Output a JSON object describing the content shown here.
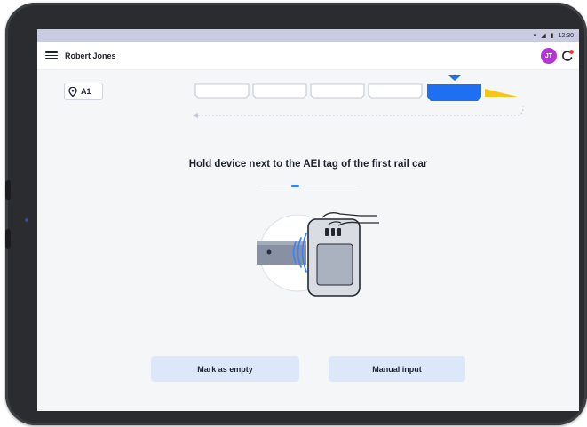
{
  "status_bar": {
    "time": "12:30"
  },
  "header": {
    "user_name": "Robert Jones",
    "avatar_initials": "JT"
  },
  "location": {
    "label": "A1"
  },
  "instruction": {
    "prefix": "Hold device next to the AEI tag of the ",
    "emphasis": "first",
    "suffix": " rail car"
  },
  "actions": {
    "mark_empty_label": "Mark as empty",
    "manual_input_label": "Manual input"
  },
  "colors": {
    "accent_blue": "#1e6ff2",
    "locomotive_yellow": "#f5c518",
    "avatar": "#b235d6",
    "button_bg": "#dde7fa"
  },
  "progress": {
    "step": 2,
    "total_steps": 6
  },
  "train": {
    "empty_cars": 4,
    "active_car_index": 5
  }
}
